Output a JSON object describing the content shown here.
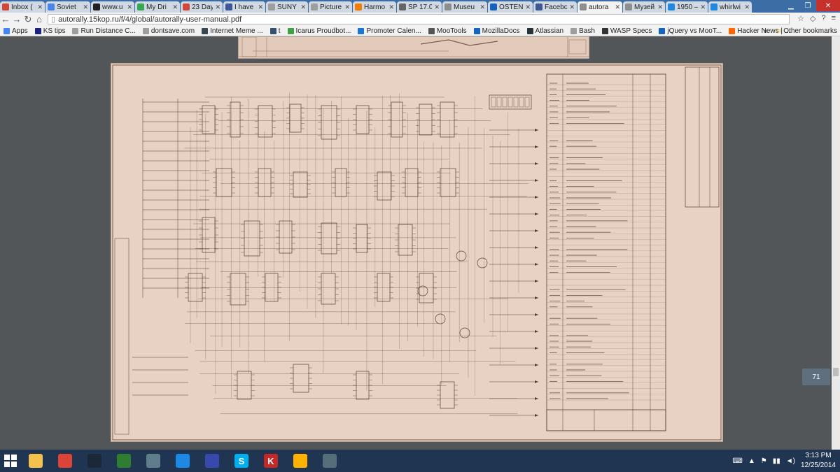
{
  "tabs": [
    {
      "label": "Inbox (",
      "color": "#d44638",
      "active": false,
      "w": 64
    },
    {
      "label": "Soviet",
      "color": "#4a86e8",
      "active": false,
      "w": 64
    },
    {
      "label": "www.u",
      "color": "#222222",
      "active": false,
      "w": 62
    },
    {
      "label": "My Dri",
      "color": "#34a853",
      "active": false,
      "w": 64
    },
    {
      "label": "23 Day",
      "color": "#d44638",
      "active": false,
      "w": 60
    },
    {
      "label": "I have",
      "color": "#3b5998",
      "active": false,
      "w": 60
    },
    {
      "label": "SUNY",
      "color": "#9e9e9e",
      "active": false,
      "w": 60
    },
    {
      "label": "Picture",
      "color": "#9e9e9e",
      "active": false,
      "w": 62
    },
    {
      "label": "Harmo",
      "color": "#f57c00",
      "active": false,
      "w": 62
    },
    {
      "label": "SP 17.06",
      "color": "#666666",
      "active": false,
      "w": 64
    },
    {
      "label": "Museu",
      "color": "#8e8e8e",
      "active": false,
      "w": 64
    },
    {
      "label": "OSTEN",
      "color": "#1565c0",
      "active": false,
      "w": 64
    },
    {
      "label": "Facebo",
      "color": "#3b5998",
      "active": false,
      "w": 62
    },
    {
      "label": "autora",
      "color": "#8e8e8e",
      "active": true,
      "w": 64
    },
    {
      "label": "Музей",
      "color": "#8e8e8e",
      "active": false,
      "w": 60
    },
    {
      "label": "1950 –",
      "color": "#1e88e5",
      "active": false,
      "w": 60
    },
    {
      "label": "whirlwi",
      "color": "#1e88e5",
      "active": false,
      "w": 62
    }
  ],
  "address": {
    "url": "autorally.15kop.ru/f/4/global/autorally-user-manual.pdf"
  },
  "bookmarks": [
    {
      "label": "Apps",
      "color": "#4285f4"
    },
    {
      "label": "KS tips",
      "color": "#1a237e"
    },
    {
      "label": "Run Distance C...",
      "color": "#9e9e9e"
    },
    {
      "label": "dontsave.com",
      "color": "#9e9e9e"
    },
    {
      "label": "Internet Meme ...",
      "color": "#37474f"
    },
    {
      "label": "t",
      "color": "#34526f"
    },
    {
      "label": "Icarus Proudbot...",
      "color": "#43a047"
    },
    {
      "label": "Promoter Calen...",
      "color": "#1976d2"
    },
    {
      "label": "MooTools",
      "color": "#555555"
    },
    {
      "label": "MozillaDocs",
      "color": "#1565c0"
    },
    {
      "label": "Atlassian",
      "color": "#263238"
    },
    {
      "label": "Bash",
      "color": "#9e9e9e"
    },
    {
      "label": "WASP Specs",
      "color": "#333333"
    },
    {
      "label": "jQuery vs MooT...",
      "color": "#1565c0"
    },
    {
      "label": "Hacker News | ...",
      "color": "#ff6600"
    }
  ],
  "bookmarks_overflow": "»",
  "other_bookmarks": "Other bookmarks",
  "page_badge": "71",
  "clock": {
    "time": "3:13 PM",
    "date": "12/25/2014"
  },
  "taskbar_apps": [
    {
      "name": "file-explorer",
      "color": "#f2c14e",
      "glyph": ""
    },
    {
      "name": "chrome",
      "color": "#db4437",
      "glyph": ""
    },
    {
      "name": "steam",
      "color": "#1b2838",
      "glyph": ""
    },
    {
      "name": "app-x",
      "color": "#2e7d32",
      "glyph": ""
    },
    {
      "name": "pencil-app",
      "color": "#607d8b",
      "glyph": ""
    },
    {
      "name": "wave-app",
      "color": "#1e88e5",
      "glyph": ""
    },
    {
      "name": "graph-app",
      "color": "#3949ab",
      "glyph": ""
    },
    {
      "name": "skype",
      "color": "#00aff0",
      "glyph": "S"
    },
    {
      "name": "k-app",
      "color": "#c62828",
      "glyph": "K"
    },
    {
      "name": "circle-app",
      "color": "#ffb300",
      "glyph": ""
    },
    {
      "name": "image-app",
      "color": "#546e7a",
      "glyph": ""
    }
  ]
}
